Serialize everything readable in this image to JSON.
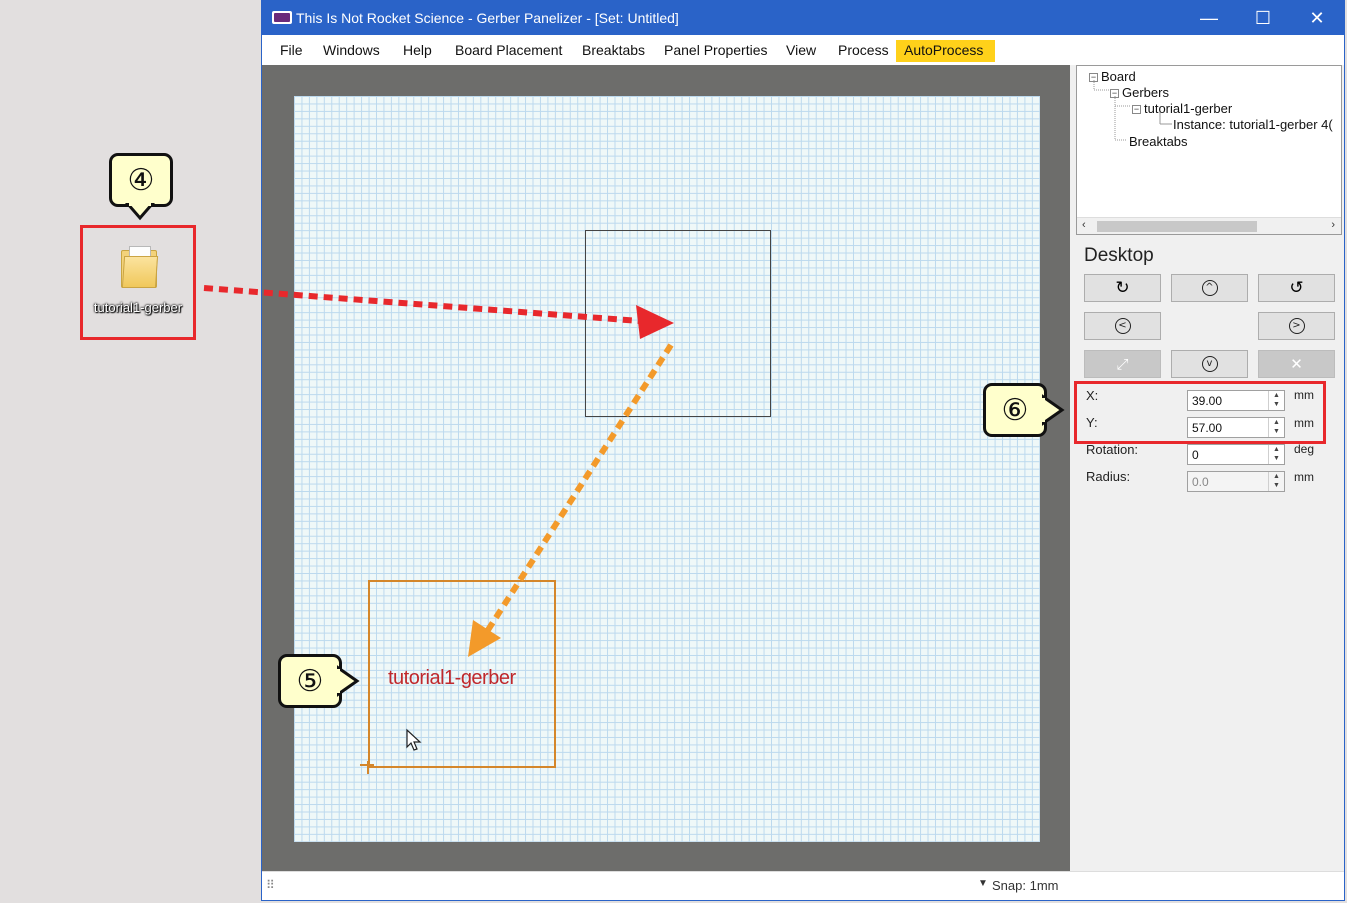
{
  "desktop": {
    "icon_label": "tutorial1-gerber"
  },
  "callouts": {
    "four": "④",
    "five": "⑤",
    "six": "⑥"
  },
  "window": {
    "title": "This Is Not Rocket Science - Gerber Panelizer - [Set: Untitled]",
    "controls": {
      "minimize": "—",
      "maximize": "☐",
      "close": "✕"
    }
  },
  "menu": {
    "items": [
      "File",
      "Windows",
      "Help",
      "Board Placement",
      "Breaktabs",
      "Panel Properties",
      "View",
      "Process",
      "AutoProcess"
    ]
  },
  "canvas": {
    "board_label": "tutorial1-gerber",
    "colors": {
      "board_outline": "#d4862a",
      "board_text": "#c0282c",
      "arrow_red": "#e8282c",
      "arrow_orange": "#f39a2a"
    }
  },
  "tree": {
    "board": "Board",
    "gerbers": "Gerbers",
    "gerber_item": "tutorial1-gerber",
    "instance": "Instance: tutorial1-gerber 4(",
    "breaktabs": "Breaktabs"
  },
  "panel": {
    "title": "Desktop",
    "x_label": "X:",
    "x_value": "39.00",
    "y_label": "Y:",
    "y_value": "57.00",
    "rotation_label": "Rotation:",
    "rotation_value": "0",
    "radius_label": "Radius:",
    "radius_value": "0.0",
    "unit_mm": "mm",
    "unit_deg": "deg"
  },
  "status": {
    "snap": "Snap: 1mm",
    "resize_grip": "⠿"
  }
}
